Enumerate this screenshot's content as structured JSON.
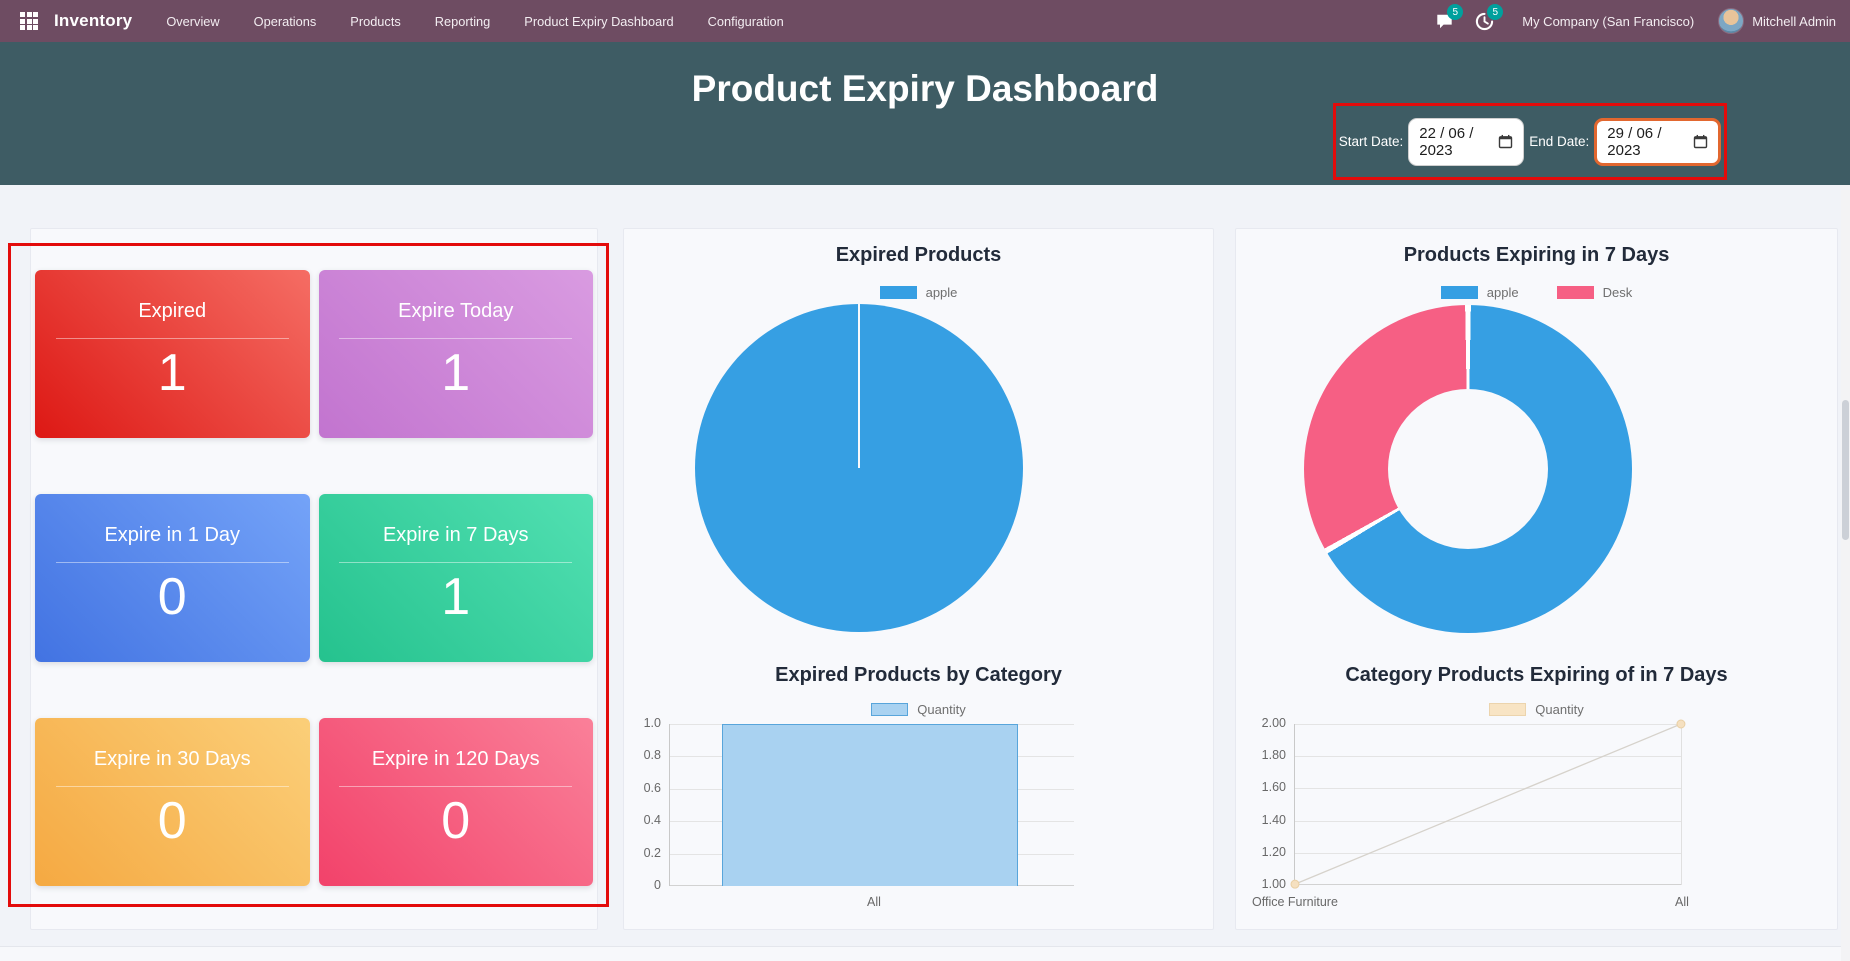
{
  "navbar": {
    "brand": "Inventory",
    "menu": [
      {
        "label": "Overview"
      },
      {
        "label": "Operations"
      },
      {
        "label": "Products"
      },
      {
        "label": "Reporting"
      },
      {
        "label": "Product Expiry Dashboard"
      },
      {
        "label": "Configuration"
      }
    ],
    "messages_badge": "5",
    "activities_badge": "5",
    "company": "My Company (San Francisco)",
    "user": "Mitchell Admin"
  },
  "header": {
    "title": "Product Expiry Dashboard",
    "start_date_label": "Start Date:",
    "start_date_value": "22 / 06 / 2023",
    "end_date_label": "End Date:",
    "end_date_value": "29 / 06 / 2023"
  },
  "tiles": [
    {
      "label": "Expired",
      "value": "1",
      "gradient": [
        "#f56d64",
        "#dd1814"
      ]
    },
    {
      "label": "Expire Today",
      "value": "1",
      "gradient": [
        "#d99be1",
        "#c274cf"
      ]
    },
    {
      "label": "Expire in 1 Day",
      "value": "0",
      "gradient": [
        "#74a3f8",
        "#4273e2"
      ]
    },
    {
      "label": "Expire in 7 Days",
      "value": "1",
      "gradient": [
        "#52e0b2",
        "#25c28e"
      ]
    },
    {
      "label": "Expire in 30 Days",
      "value": "0",
      "gradient": [
        "#fbcf79",
        "#f5a942"
      ]
    },
    {
      "label": "Expire in 120 Days",
      "value": "0",
      "gradient": [
        "#fa8099",
        "#f2426a"
      ]
    }
  ],
  "chart_data": [
    {
      "type": "pie",
      "title": "Expired Products",
      "labels": [
        "apple"
      ],
      "values": [
        1
      ],
      "colors": [
        "#369fe3"
      ],
      "legend_position": "top"
    },
    {
      "type": "bar",
      "title": "Expired Products by Category",
      "categories": [
        "All"
      ],
      "series": [
        {
          "name": "Quantity",
          "values": [
            1
          ]
        }
      ],
      "ylim": [
        0,
        1
      ],
      "yticks": [
        "1.0",
        "0.8",
        "0.6",
        "0.4",
        "0.2",
        "0"
      ],
      "bar_fill": "#a9d2f1",
      "bar_border": "#58a5db",
      "grid": true,
      "legend_position": "top"
    },
    {
      "type": "doughnut",
      "title": "Products Expiring in 7 Days",
      "labels": [
        "apple",
        "Desk"
      ],
      "values": [
        2,
        1
      ],
      "colors": [
        "#369fe3",
        "#f65f84"
      ],
      "legend_position": "top"
    },
    {
      "type": "line",
      "title": "Category Products Expiring of in 7 Days",
      "categories": [
        "Office Furniture",
        "All"
      ],
      "series": [
        {
          "name": "Quantity",
          "values": [
            1,
            2
          ]
        }
      ],
      "ylim": [
        1,
        2
      ],
      "yticks": [
        "2.00",
        "1.80",
        "1.60",
        "1.40",
        "1.20",
        "1.00"
      ],
      "line_color": "#d6d2cb",
      "marker_color": "#f5e0c0",
      "grid": true,
      "legend_position": "top"
    }
  ],
  "colors": {
    "navbar_bg": "#6e4c62",
    "hero_bg": "#3e5c64",
    "badge_teal": "#00a09d",
    "annotation_red": "#e30b0b",
    "focus_orange": "#e2672f",
    "page_bg": "#f1f3f8",
    "panel_bg": "#f8f9fc"
  }
}
